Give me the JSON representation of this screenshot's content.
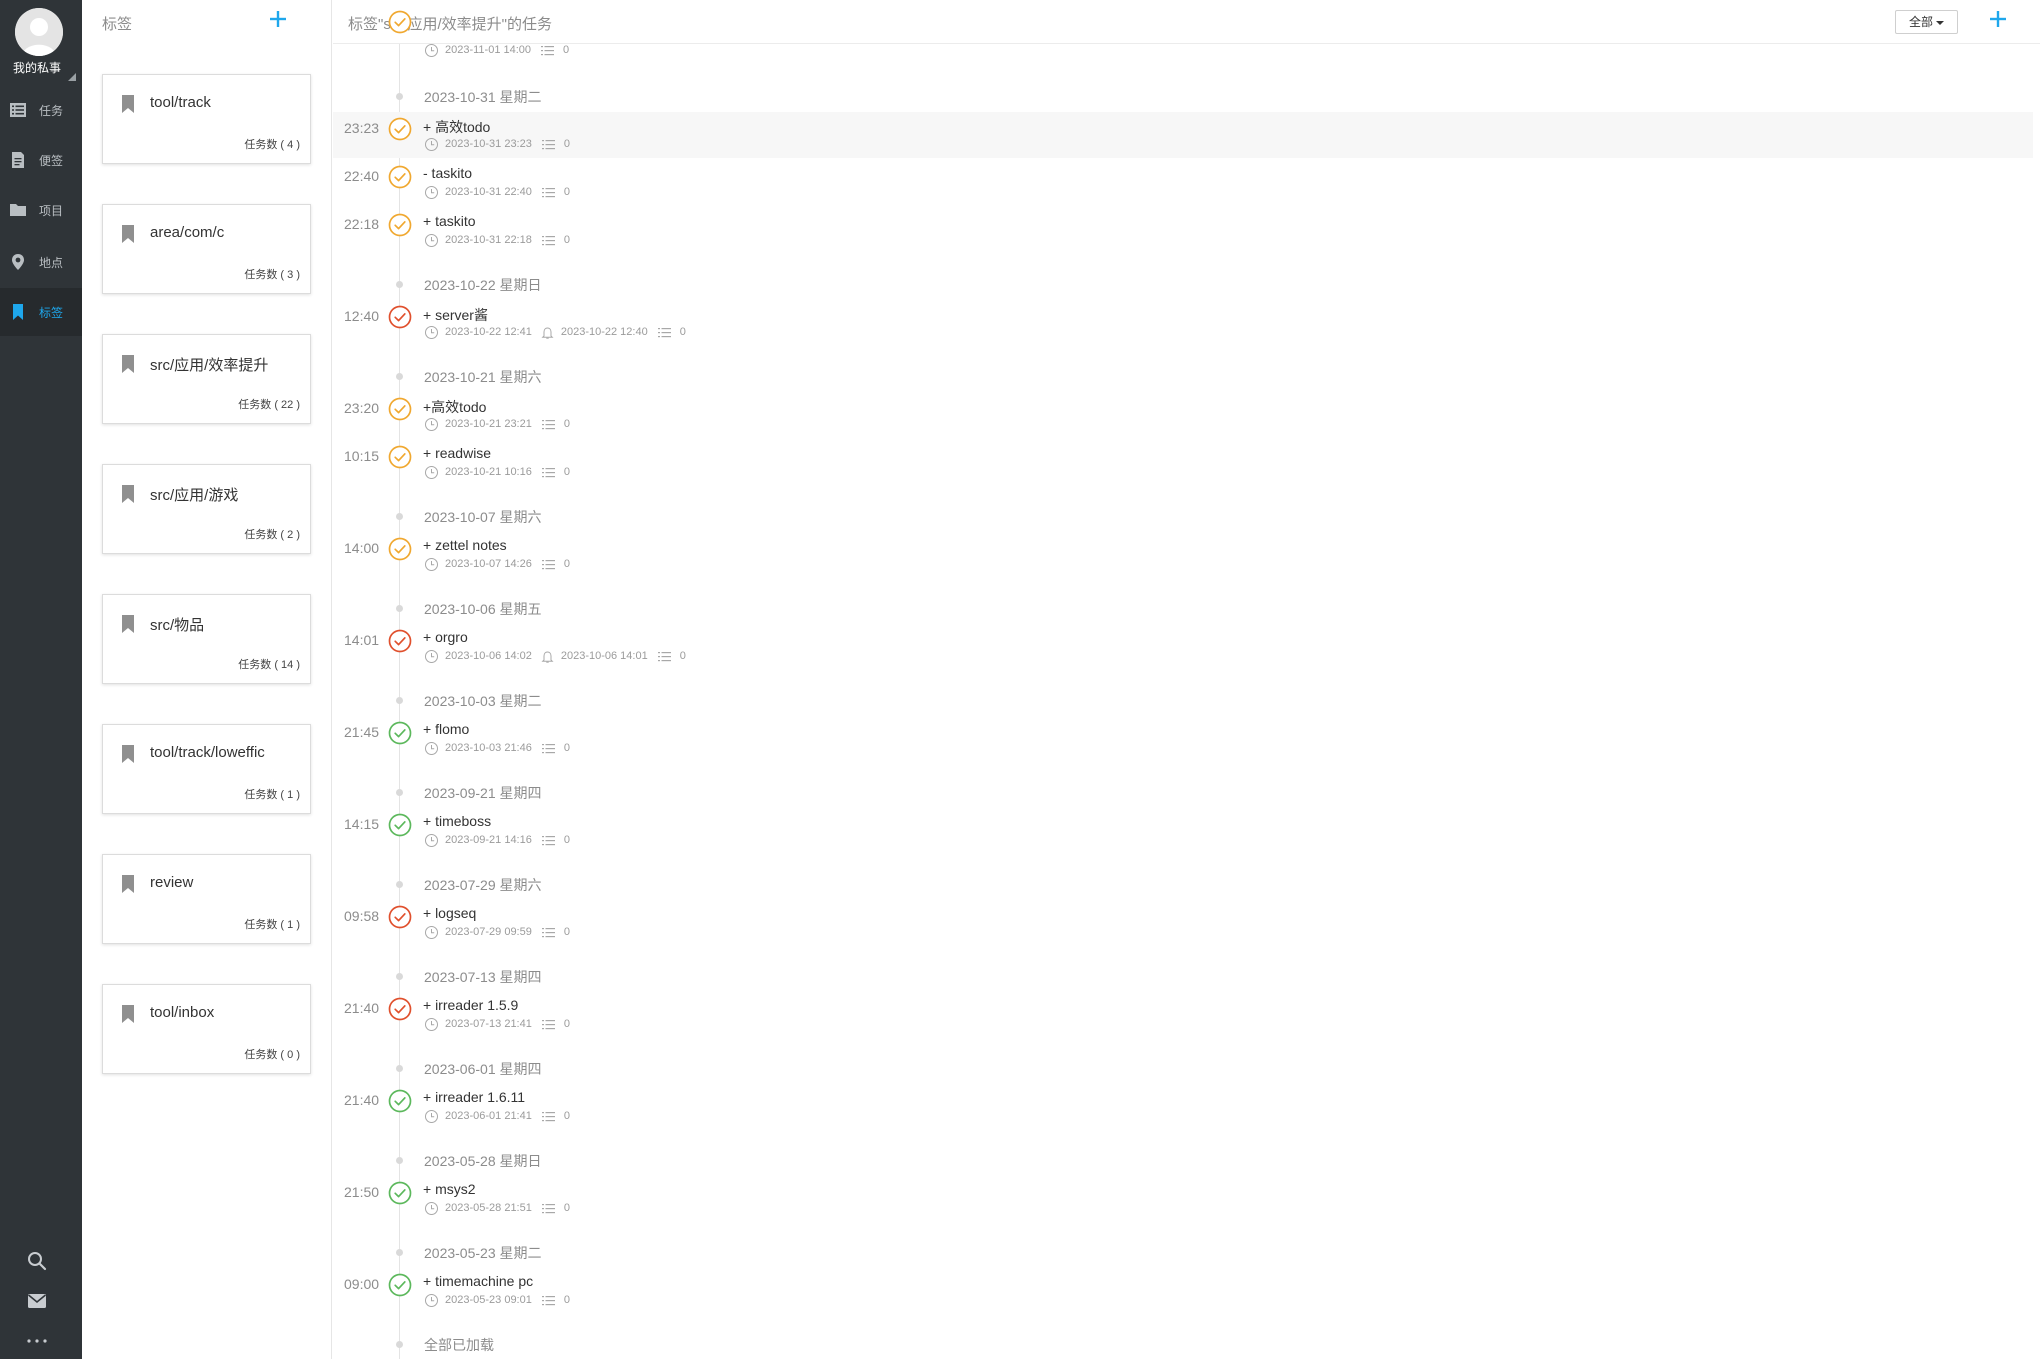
{
  "nav": {
    "user_name": "我的私事",
    "items": [
      {
        "label": "任务",
        "icon": "list-icon"
      },
      {
        "label": "便签",
        "icon": "note-icon"
      },
      {
        "label": "项目",
        "icon": "folder-icon"
      },
      {
        "label": "地点",
        "icon": "location-pin-icon"
      },
      {
        "label": "标签",
        "icon": "bookmark-icon",
        "active": true
      }
    ],
    "bottom_icons": [
      "search-icon",
      "mail-icon",
      "more-icon"
    ],
    "accent_color": "#1ea7ec"
  },
  "tag_panel": {
    "title": "标签",
    "tags": [
      {
        "name": "tool/track",
        "count": "任务数 ( 4 )"
      },
      {
        "name": "area/com/c",
        "count": "任务数 ( 3 )"
      },
      {
        "name": "src/应用/效率提升",
        "count": "任务数 ( 22 )"
      },
      {
        "name": "src/应用/游戏",
        "count": "任务数 ( 2 )"
      },
      {
        "name": "src/物品",
        "count": "任务数 ( 14 )"
      },
      {
        "name": "tool/track/loweffic",
        "count": "任务数 ( 1 )"
      },
      {
        "name": "review",
        "count": "任务数 ( 1 )"
      },
      {
        "name": "tool/inbox",
        "count": "任务数 ( 0 )"
      }
    ]
  },
  "main": {
    "title": "标签\"src/应用/效率提升\"的任务",
    "filter_label": "全部",
    "status_colors": {
      "orange": "#f0a830",
      "red": "#e0502d",
      "green": "#5cb85c"
    },
    "partial_meta": {
      "created": "2023-11-01 14:00",
      "count": "0"
    },
    "groups": [
      {
        "date": "2023-10-31 星期二",
        "tasks": [
          {
            "time": "23:23",
            "title": "+ 高效todo",
            "created": "2023-10-31 23:23",
            "count": "0",
            "status": "orange",
            "highlight": true
          },
          {
            "time": "22:40",
            "title": "- taskito",
            "created": "2023-10-31 22:40",
            "count": "0",
            "status": "orange"
          },
          {
            "time": "22:18",
            "title": "+ taskito",
            "created": "2023-10-31 22:18",
            "count": "0",
            "status": "orange"
          }
        ]
      },
      {
        "date": "2023-10-22 星期日",
        "tasks": [
          {
            "time": "12:40",
            "title": "+ server酱",
            "created": "2023-10-22 12:41",
            "reminder": "2023-10-22 12:40",
            "count": "0",
            "status": "red"
          }
        ]
      },
      {
        "date": "2023-10-21 星期六",
        "tasks": [
          {
            "time": "23:20",
            "title": "+高效todo",
            "created": "2023-10-21 23:21",
            "count": "0",
            "status": "orange"
          },
          {
            "time": "10:15",
            "title": "+ readwise",
            "created": "2023-10-21 10:16",
            "count": "0",
            "status": "orange"
          }
        ]
      },
      {
        "date": "2023-10-07 星期六",
        "tasks": [
          {
            "time": "14:00",
            "title": "+ zettel notes",
            "created": "2023-10-07 14:26",
            "count": "0",
            "status": "orange"
          }
        ]
      },
      {
        "date": "2023-10-06 星期五",
        "tasks": [
          {
            "time": "14:01",
            "title": "+ orgro",
            "created": "2023-10-06 14:02",
            "reminder": "2023-10-06 14:01",
            "count": "0",
            "status": "red"
          }
        ]
      },
      {
        "date": "2023-10-03 星期二",
        "tasks": [
          {
            "time": "21:45",
            "title": "+ flomo",
            "created": "2023-10-03 21:46",
            "count": "0",
            "status": "green"
          }
        ]
      },
      {
        "date": "2023-09-21 星期四",
        "tasks": [
          {
            "time": "14:15",
            "title": "+ timeboss",
            "created": "2023-09-21 14:16",
            "count": "0",
            "status": "green"
          }
        ]
      },
      {
        "date": "2023-07-29 星期六",
        "tasks": [
          {
            "time": "09:58",
            "title": "+ logseq",
            "created": "2023-07-29 09:59",
            "count": "0",
            "status": "red"
          }
        ]
      },
      {
        "date": "2023-07-13 星期四",
        "tasks": [
          {
            "time": "21:40",
            "title": "+ irreader 1.5.9",
            "created": "2023-07-13 21:41",
            "count": "0",
            "status": "red"
          }
        ]
      },
      {
        "date": "2023-06-01 星期四",
        "tasks": [
          {
            "time": "21:40",
            "title": "+ irreader 1.6.11",
            "created": "2023-06-01 21:41",
            "count": "0",
            "status": "green"
          }
        ]
      },
      {
        "date": "2023-05-28 星期日",
        "tasks": [
          {
            "time": "21:50",
            "title": "+ msys2",
            "created": "2023-05-28 21:51",
            "count": "0",
            "status": "green"
          }
        ]
      },
      {
        "date": "2023-05-23 星期二",
        "tasks": [
          {
            "time": "09:00",
            "title": "+ timemachine pc",
            "created": "2023-05-23 09:01",
            "count": "0",
            "status": "green"
          }
        ]
      }
    ],
    "end_text": "全部已加载"
  }
}
